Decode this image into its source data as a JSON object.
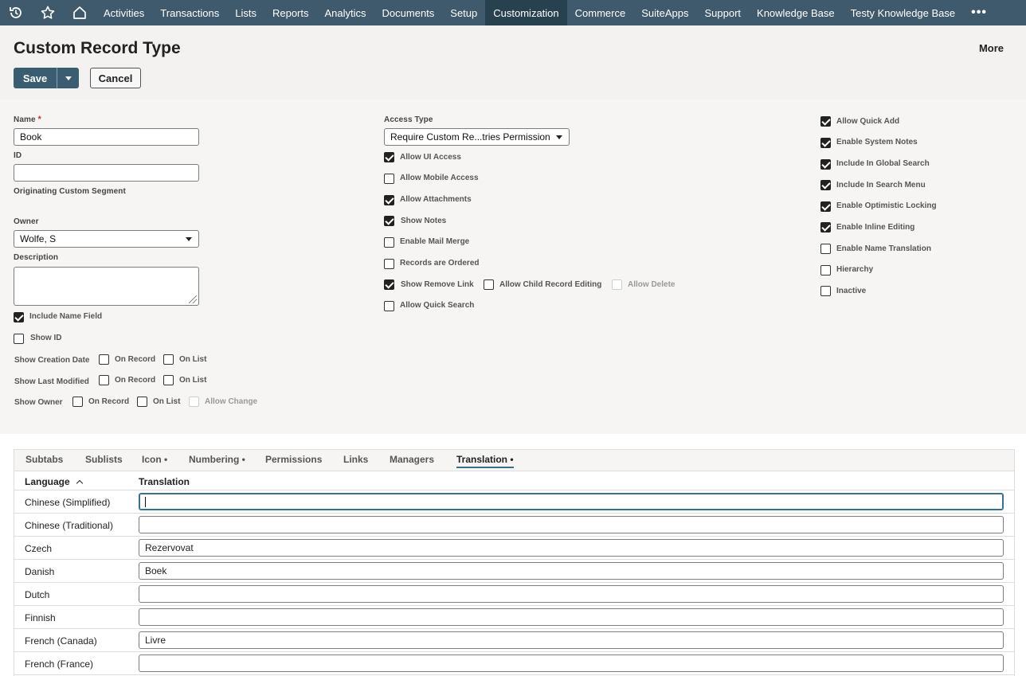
{
  "nav": {
    "items": [
      "Activities",
      "Transactions",
      "Lists",
      "Reports",
      "Analytics",
      "Documents",
      "Setup",
      "Customization",
      "Commerce",
      "SuiteApps",
      "Support",
      "Knowledge Base",
      "Testy Knowledge Base"
    ],
    "active": "Customization",
    "more": "•••",
    "icons": [
      "history-icon",
      "star-icon",
      "home-icon"
    ]
  },
  "header": {
    "title": "Custom Record Type",
    "more_label": "More",
    "save_label": "Save",
    "cancel_label": "Cancel"
  },
  "form": {
    "name_label": "Name",
    "required_mark": "*",
    "name_value": "Book",
    "id_label": "ID",
    "id_value": "",
    "origin_label": "Originating Custom Segment",
    "owner_label": "Owner",
    "owner_value": "Wolfe, S",
    "description_label": "Description",
    "include_name_field": "Include Name Field",
    "show_id": "Show ID",
    "show_creation_date": "Show Creation Date",
    "show_last_modified": "Show Last Modified",
    "show_owner": "Show Owner",
    "on_record": "On Record",
    "on_list": "On List",
    "allow_change": "Allow Change",
    "access_type_label": "Access Type",
    "access_type_value": "Require Custom Re...tries Permission",
    "allow_ui_access": "Allow UI Access",
    "allow_mobile_access": "Allow Mobile Access",
    "allow_attachments": "Allow Attachments",
    "show_notes": "Show Notes",
    "enable_mail_merge": "Enable Mail Merge",
    "records_ordered": "Records are Ordered",
    "show_remove_link": "Show Remove Link",
    "allow_child_editing": "Allow Child Record Editing",
    "allow_delete": "Allow Delete",
    "allow_quick_search": "Allow Quick Search",
    "allow_quick_add": "Allow Quick Add",
    "enable_system_notes": "Enable System Notes",
    "include_global_search": "Include In Global Search",
    "include_search_menu": "Include In Search Menu",
    "enable_optimistic_locking": "Enable Optimistic Locking",
    "enable_inline_editing": "Enable Inline Editing",
    "enable_name_translation": "Enable Name Translation",
    "hierarchy": "Hierarchy",
    "inactive": "Inactive"
  },
  "subtabs": {
    "tabs": [
      "Subtabs",
      "Sublists",
      "Icon •",
      "Numbering •",
      "Permissions",
      "Links",
      "Managers",
      "Translation •"
    ],
    "active": "Translation •",
    "col_language": "Language",
    "col_translation": "Translation",
    "rows": [
      {
        "language": "Chinese (Simplified)",
        "translation": ""
      },
      {
        "language": "Chinese (Traditional)",
        "translation": ""
      },
      {
        "language": "Czech",
        "translation": "Rezervovat"
      },
      {
        "language": "Danish",
        "translation": "Boek"
      },
      {
        "language": "Dutch",
        "translation": ""
      },
      {
        "language": "Finnish",
        "translation": ""
      },
      {
        "language": "French (Canada)",
        "translation": "Livre"
      },
      {
        "language": "French (France)",
        "translation": ""
      }
    ]
  }
}
